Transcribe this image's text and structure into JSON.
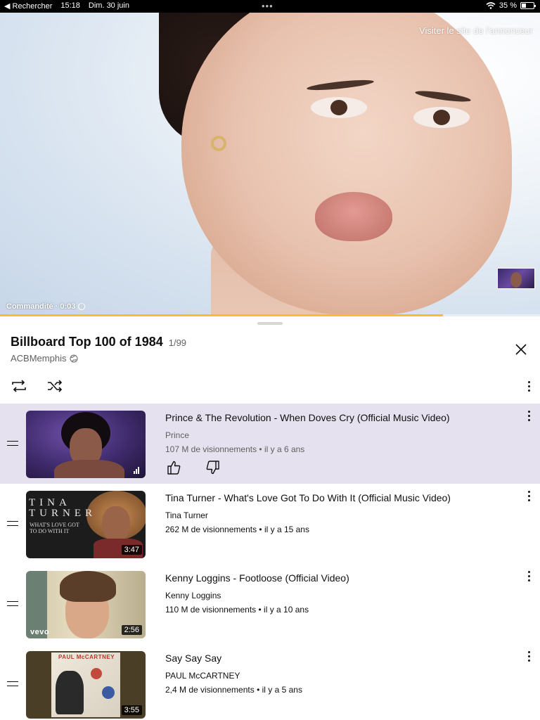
{
  "status_bar": {
    "back_label": "◀ Rechercher",
    "time": "15:18",
    "date": "Dim. 30 juin",
    "dots": "•••",
    "battery_percent": "35 %",
    "battery_level": 0.35
  },
  "player": {
    "visit_advertiser": "Visiter le site de l'annonceur",
    "ad_label": "Commandité · 0:03",
    "progress": 0.82
  },
  "playlist": {
    "title": "Billboard Top 100 of 1984",
    "position": "1/99",
    "owner": "ACBMemphis"
  },
  "thumbnails": {
    "tina_big": "TINA TURNER",
    "tina_small": "WHAT'S LOVE GOT TO DO WITH IT",
    "vevo": "vevo",
    "paul_cover": "PAUL McCARTNEY"
  },
  "videos": [
    {
      "title": "Prince & The Revolution - When Doves Cry (Official Music Video)",
      "channel": "Prince",
      "meta": "107 M de visionnements • il y a 6 ans",
      "duration": "",
      "playing": true
    },
    {
      "title": "Tina Turner - What's Love Got To Do With It (Official Music Video)",
      "channel": "Tina Turner",
      "meta": "262 M de visionnements • il y a 15 ans",
      "duration": "3:47",
      "playing": false
    },
    {
      "title": "Kenny Loggins - Footloose (Official Video)",
      "channel": "Kenny Loggins",
      "meta": "110 M de visionnements • il y a 10 ans",
      "duration": "2:56",
      "playing": false
    },
    {
      "title": "Say Say Say",
      "channel": "PAUL McCARTNEY",
      "meta": "2,4 M de visionnements • il y a 5 ans",
      "duration": "3:55",
      "playing": false
    }
  ],
  "colors": {
    "active_row": "#e6e1ee",
    "progress": "#ffb833",
    "text_primary": "#0f0f0f",
    "text_secondary": "#606060"
  },
  "icons": [
    "wifi-icon",
    "battery-icon",
    "info-icon",
    "globe-icon",
    "close-icon",
    "loop-icon",
    "shuffle-icon",
    "more-vert-icon",
    "drag-handle-icon",
    "thumb-up-icon",
    "thumb-down-icon",
    "now-playing-icon"
  ]
}
